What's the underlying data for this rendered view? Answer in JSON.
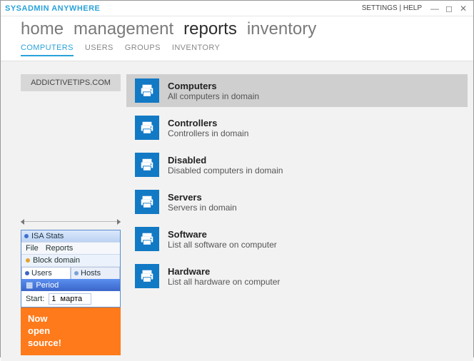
{
  "window": {
    "title": "SYSADMIN ANYWHERE",
    "settings": "SETTINGS",
    "help": "HELP"
  },
  "nav": {
    "items": [
      "home",
      "management",
      "reports",
      "inventory"
    ],
    "active_index": 2
  },
  "subnav": {
    "items": [
      "COMPUTERS",
      "USERS",
      "GROUPS",
      "INVENTORY"
    ],
    "active_index": 0
  },
  "sidebar": {
    "domain": "ADDICTIVETIPS.COM"
  },
  "reports": [
    {
      "title": "Computers",
      "desc": "All computers in domain",
      "selected": true
    },
    {
      "title": "Controllers",
      "desc": "Controllers in domain",
      "selected": false
    },
    {
      "title": "Disabled",
      "desc": "Disabled computers in domain",
      "selected": false
    },
    {
      "title": "Servers",
      "desc": "Servers in domain",
      "selected": false
    },
    {
      "title": "Software",
      "desc": "List all software on computer",
      "selected": false
    },
    {
      "title": "Hardware",
      "desc": "List all hardware on computer",
      "selected": false
    }
  ],
  "promo": {
    "winlet_title": "ISA Stats",
    "file": "File",
    "reports": "Reports",
    "block": "Block domain",
    "tab_users": "Users",
    "tab_hosts": "Hosts",
    "period": "Period",
    "start_label": "Start:",
    "start_value": "1  марта",
    "banner_l1": "Now",
    "banner_l2": "open",
    "banner_l3": "source!"
  }
}
